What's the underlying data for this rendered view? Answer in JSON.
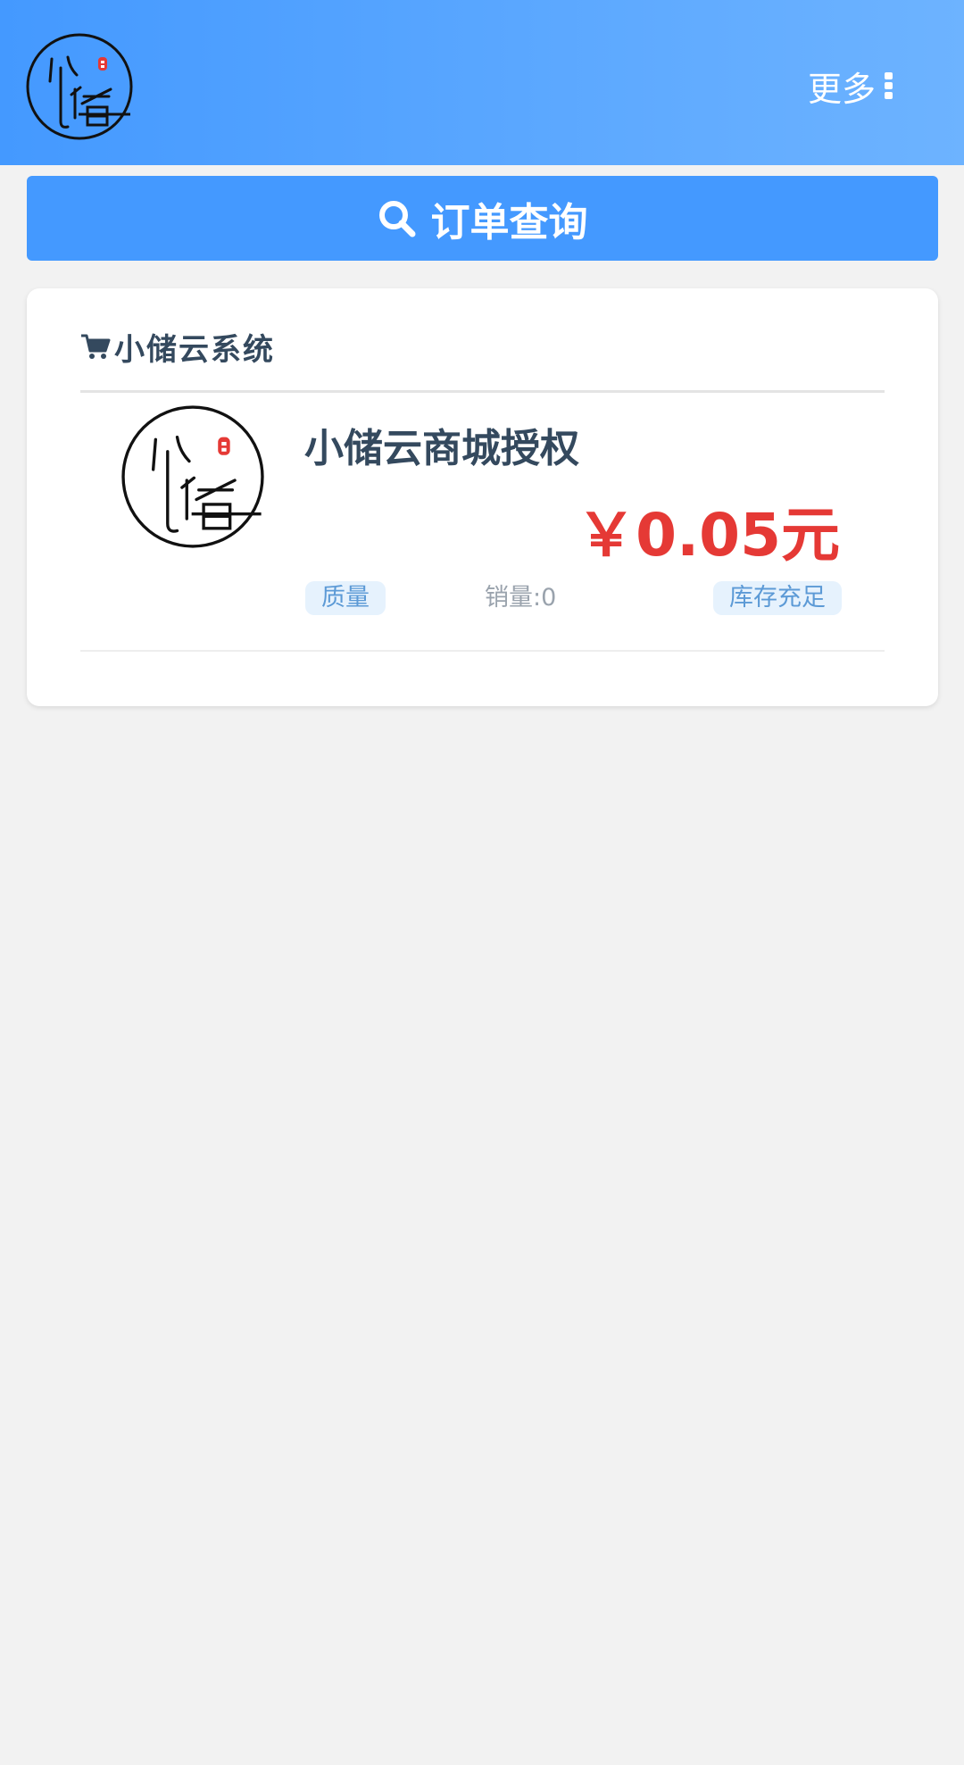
{
  "header": {
    "logo_text": "小储",
    "more_label": "更多"
  },
  "search": {
    "label": "订单查询"
  },
  "category": {
    "title": "小储云系统",
    "products": [
      {
        "name": "小储云商城授权",
        "price": "￥0.05元",
        "quality_tag": "质量",
        "sales": "销量:0",
        "stock_tag": "库存充足"
      }
    ]
  },
  "colors": {
    "header_start": "#4499ff",
    "header_end": "#6db3ff",
    "primary": "#4499ff",
    "price": "#e53935",
    "tag_text": "#5c9ad6",
    "tag_bg": "#e6f2fd",
    "page_bg": "#f2f2f2"
  },
  "icons": {
    "more": "ellipsis-vertical-icon",
    "search": "search-icon",
    "cart": "cart-icon"
  }
}
